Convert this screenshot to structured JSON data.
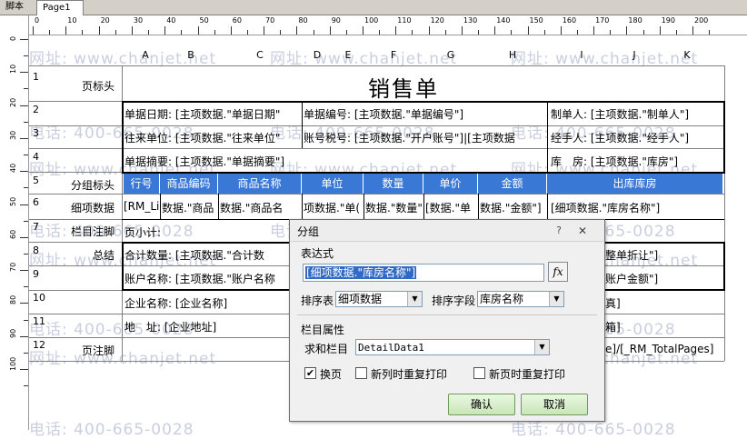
{
  "tabs": [
    {
      "label": "脚本"
    },
    {
      "label": "Page1"
    }
  ],
  "ruler": {
    "top_numbers": [
      "0",
      "10",
      "20",
      "30",
      "40",
      "50",
      "60",
      "70",
      "80",
      "90",
      "100",
      "110",
      "120",
      "130",
      "140",
      "150",
      "160",
      "170",
      "180",
      "190",
      "200"
    ],
    "left_numbers": [
      "0",
      "10",
      "20",
      "30",
      "40",
      "50",
      "60",
      "70",
      "80",
      "90",
      "100"
    ]
  },
  "watermarks": {
    "site": "网址: www.chanjet.net",
    "phone": "电话: 400-665-0028"
  },
  "columns": [
    "A",
    "B",
    "C",
    "D",
    "E",
    "F",
    "G",
    "H",
    "I",
    "J",
    "K"
  ],
  "rows": [
    {
      "index": "1",
      "band": "页标头"
    },
    {
      "index": "2",
      "band": ""
    },
    {
      "index": "3",
      "band": ""
    },
    {
      "index": "4",
      "band": ""
    },
    {
      "index": "5",
      "band": "分组标头"
    },
    {
      "index": "6",
      "band": "细项数据"
    },
    {
      "index": "7",
      "band": "栏目注脚"
    },
    {
      "index": "8",
      "band": "总结"
    },
    {
      "index": "9",
      "band": ""
    },
    {
      "index": "10",
      "band": ""
    },
    {
      "index": "11",
      "band": ""
    },
    {
      "index": "12",
      "band": "页注脚"
    }
  ],
  "report": {
    "title": "销售单",
    "row2": {
      "c1": "单据日期: [主项数据.\"单据日期\"",
      "c2": "单据编号: [主项数据.\"单据编号\"]",
      "c3": "制单人: [主项数据.\"制单人\"]"
    },
    "row3": {
      "c1": "往来单位: [主项数据.\"往来单位\"",
      "c2": "账号税号: [主项数据.\"开户账号\"]|[主项数据",
      "c3": "经手人: [主项数据.\"经手人\"]"
    },
    "row4": {
      "c1": "单据摘要: [主项数据.\"单据摘要\"]",
      "c2": "库　房: [主项数据.\"库房\"]"
    },
    "header_cells": [
      "行号",
      "商品编码",
      "商品名称",
      "单位",
      "数量",
      "单价",
      "金额",
      "出库库房"
    ],
    "detail_cells": [
      "[RM_Lir",
      "数据.\"商品",
      "数据.\"商品名",
      "项数据.\"单(",
      "数据.\"数量\"]",
      "[数据.\"单",
      "数据.\"金额\"]",
      "[细项数据.\"库房名称\"]"
    ],
    "row7": "页小计:",
    "row8": {
      "c1": "合计数量: [主项数据.\"合计数",
      "c2": "整单折让\"]"
    },
    "row9": {
      "c1": "账户名称: [主项数据.\"账户名称",
      "c2": "账户金额\"]"
    },
    "row10": {
      "c1": "企业名称: [企业名称]",
      "c2": "真]"
    },
    "row11": {
      "c1": "地　址: [企业地址]",
      "c2": "箱]"
    },
    "row12": {
      "c2": "e]/[_RM_TotalPages]"
    }
  },
  "dialog": {
    "title": "分组",
    "help": "?",
    "close": "✕",
    "expr_label": "表达式",
    "expr_value": "[细项数据.\"库房名称\"]",
    "fx_label": "fx",
    "sort_table_label": "排序表",
    "sort_table_value": "细项数据",
    "sort_field_label": "排序字段",
    "sort_field_value": "库房名称",
    "section_label": "栏目属性",
    "sum_label": "求和栏目",
    "sum_value": "DetailData1",
    "check_page_break": {
      "label": "换页",
      "checked": true
    },
    "check_newcol_reprint": {
      "label": "新列时重复打印",
      "checked": false
    },
    "check_newpage_reprint": {
      "label": "新页时重复打印",
      "checked": false
    },
    "ok_label": "确认",
    "cancel_label": "取消"
  }
}
